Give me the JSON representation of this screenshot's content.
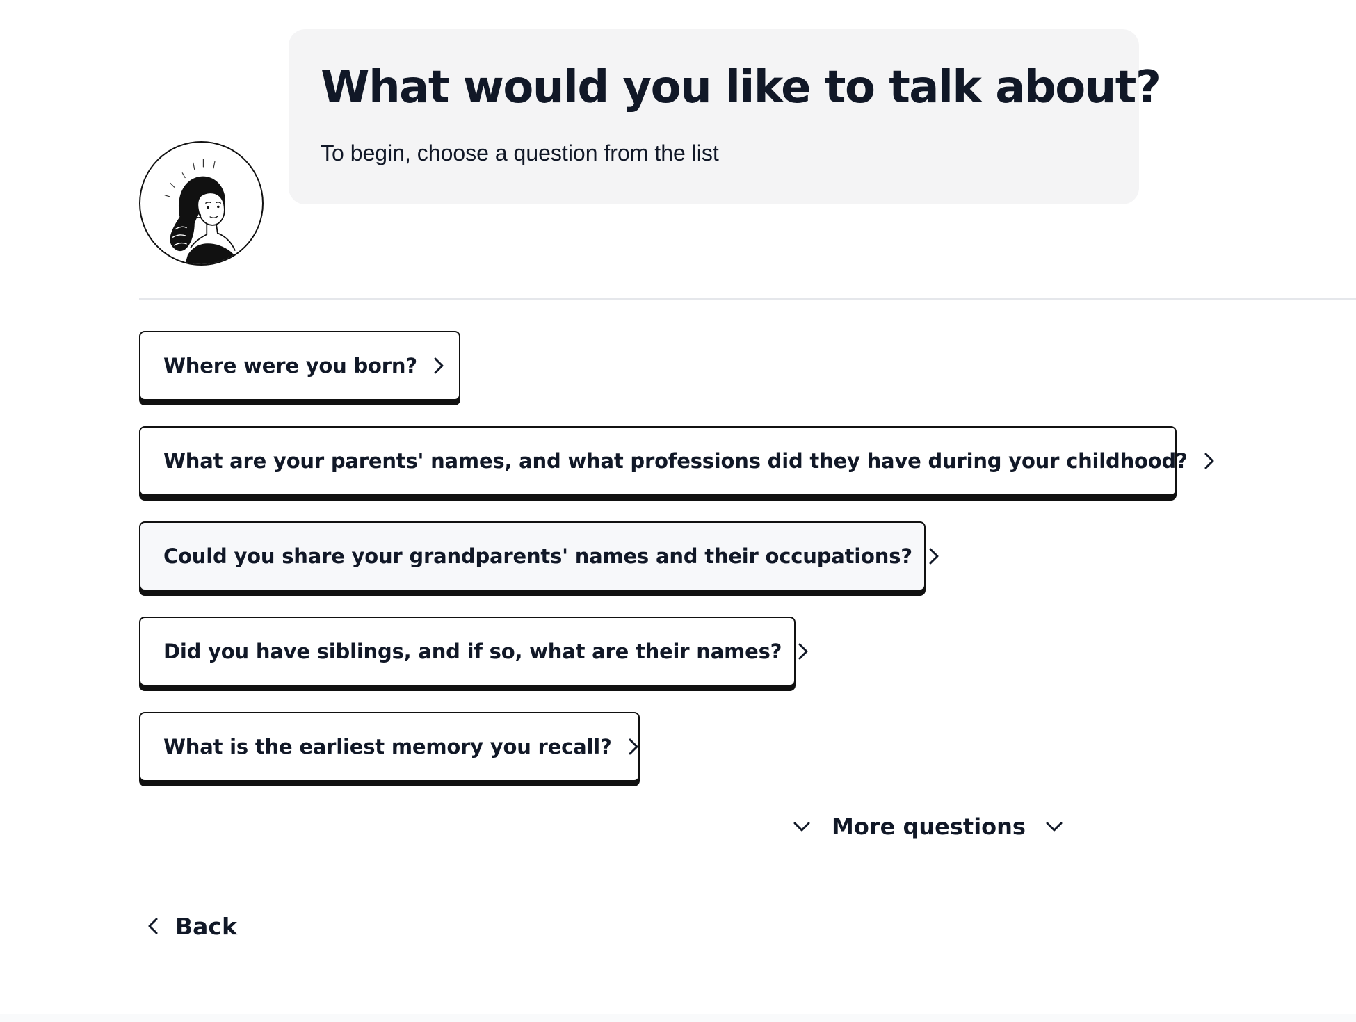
{
  "header": {
    "title": "What would you like to talk about?",
    "subtitle": "To begin, choose a question from the list"
  },
  "avatar": {
    "icon": "woman-portrait-illustration"
  },
  "questions": [
    {
      "label": "Where were you born?"
    },
    {
      "label": "What are your parents' names, and what professions did they have during your childhood?"
    },
    {
      "label": "Could you share your grandparents' names and their occupations?"
    },
    {
      "label": "Did you have siblings, and if so, what are their names?"
    },
    {
      "label": "What is the earliest memory you recall?"
    }
  ],
  "more": {
    "label": "More questions",
    "icon": "chevron-down-icon"
  },
  "back": {
    "label": "Back",
    "icon": "chevron-left-icon"
  },
  "colors": {
    "text": "#111827",
    "bubble_bg": "#f4f4f5",
    "border": "#111111",
    "divider": "#e5e7eb"
  }
}
